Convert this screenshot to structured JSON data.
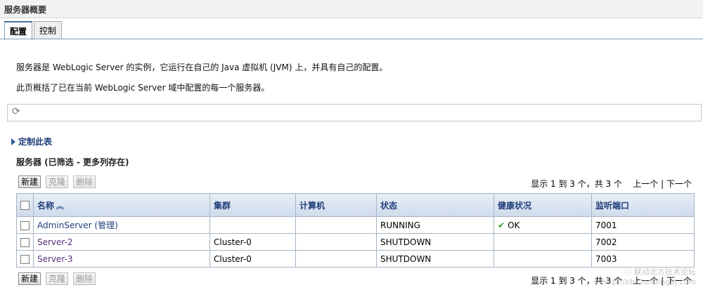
{
  "page": {
    "title": "服务器概要"
  },
  "tabs": [
    {
      "label": "配置",
      "active": true
    },
    {
      "label": "控制",
      "active": false
    }
  ],
  "description": {
    "line1": "服务器是 WebLogic Server 的实例，它运行在自己的 Java 虚拟机 (JVM) 上，并具有自己的配置。",
    "line2": "此页概括了已在当前 WebLogic Server 域中配置的每一个服务器。"
  },
  "toolbar": {
    "refresh_icon": "refresh-icon"
  },
  "customize": {
    "label": "定制此表"
  },
  "table": {
    "title": "服务器 (已筛选 - 更多列存在)",
    "buttons": {
      "new": "新建",
      "clone": "克隆",
      "delete": "删除"
    },
    "pager": {
      "summary": "显示 1 到 3 个，共 3 个",
      "prev": "上一个",
      "separator": "|",
      "next": "下一个"
    },
    "columns": {
      "name": "名称",
      "cluster": "集群",
      "machine": "计算机",
      "state": "状态",
      "health": "健康状况",
      "port": "监听端口"
    },
    "rows": [
      {
        "name": "AdminServer (管理)",
        "cluster": "",
        "machine": "",
        "state": "RUNNING",
        "health": "OK",
        "port": "7001"
      },
      {
        "name": "Server-2",
        "cluster": "Cluster-0",
        "machine": "",
        "state": "SHUTDOWN",
        "health": "",
        "port": "7002"
      },
      {
        "name": "Server-3",
        "cluster": "Cluster-0",
        "machine": "",
        "state": "SHUTDOWN",
        "health": "",
        "port": "7003"
      }
    ]
  },
  "watermark": {
    "line1": "ⓘ 联动北方技术论坛",
    "line2": "http://bbs.landingbj.com"
  }
}
